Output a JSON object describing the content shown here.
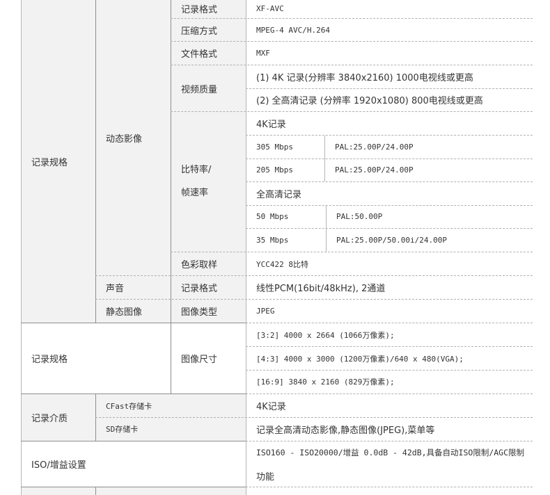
{
  "specs": {
    "rec_format_label": "记录格式",
    "rec_format_value": "XF-AVC",
    "compression_label": "压缩方式",
    "compression_value": "MPEG-4 AVC/H.264",
    "file_format_label": "文件格式",
    "file_format_value": "MXF",
    "video_quality_label": "视频质量",
    "video_quality_4k": "(1) 4K 记录(分辨率 3840x2160) 1000电视线或更高",
    "video_quality_fhd": "(2) 全高清记录 (分辨率 1920x1080) 800电视线或更高",
    "bitrate_label_1": "比特率/",
    "bitrate_label_2": "帧速率",
    "bitrate_4k_header": "4K记录",
    "bitrate_4k_rows": [
      {
        "rate": "305 Mbps",
        "fps": "PAL:25.00P/24.00P"
      },
      {
        "rate": "205 Mbps",
        "fps": "PAL:25.00P/24.00P"
      }
    ],
    "bitrate_fhd_header": "全高清记录",
    "bitrate_fhd_rows": [
      {
        "rate": "50 Mbps",
        "fps": "PAL:50.00P"
      },
      {
        "rate": "35 Mbps",
        "fps": "PAL:25.00P/50.00i/24.00P"
      }
    ],
    "color_label": "色彩取样",
    "color_value": "YCC422 8比特",
    "movie_label": "动态影像",
    "record_spec_label": "记录规格",
    "audio_label": "声音",
    "audio_format_label": "记录格式",
    "audio_format_value": "线性PCM(16bit/48kHz), 2通道",
    "still_label": "静态图像",
    "still_type_label": "图像类型",
    "still_type_value": "JPEG",
    "record_spec2_label": "记录规格",
    "image_size_label": "图像尺寸",
    "image_sizes": [
      "[3:2] 4000 x 2664 (1066万像素);",
      "[4:3] 4000 x 3000 (1200万像素)/640 x 480(VGA);",
      "[16:9] 3840 x 2160 (829万像素);"
    ],
    "media_label": "记录介质",
    "cfast_label": "CFast存储卡",
    "cfast_value": "4K记录",
    "sd_label": "SD存储卡",
    "sd_value": "记录全高清动态影像,静态图像(JPEG),菜单等",
    "iso_label": "ISO/增益设置",
    "iso_value_1": "ISO160 - ISO20000/增益 0.0dB - 42dB,具备自动ISO限制/AGC限制",
    "iso_value_2": "功能"
  }
}
